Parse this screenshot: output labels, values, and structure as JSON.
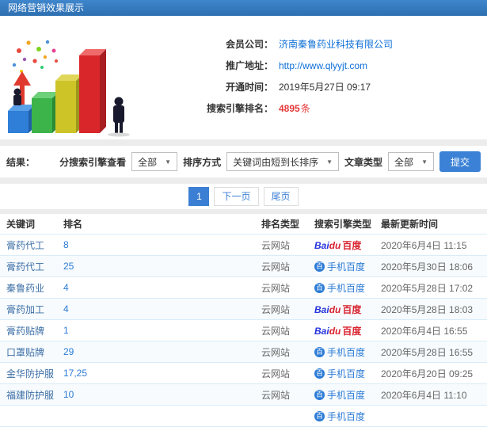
{
  "header": {
    "title": "网络营销效果展示"
  },
  "info": {
    "fields": [
      {
        "label": "会员公司：",
        "value": "济南秦鲁药业科技有限公司"
      },
      {
        "label": "推广地址：",
        "value": "http://www.qlyyjt.com"
      },
      {
        "label": "开通时间：",
        "value": "2019年5月27日 09:17"
      },
      {
        "label": "搜索引擎排名：",
        "value": "4895",
        "suffix": "条"
      }
    ]
  },
  "filters": {
    "result_label": "结果：",
    "engine_label": "分搜索引擎查看",
    "engine_value": "全部",
    "sort_label": "排序方式",
    "sort_value": "关键词由短到长排序",
    "article_label": "文章类型",
    "article_value": "全部",
    "submit_label": "提交"
  },
  "pagination": {
    "current": "1",
    "next_label": "下一页",
    "last_label": "尾页"
  },
  "table": {
    "headers": [
      "关键词",
      "排名",
      "排名类型",
      "搜索引擎类型",
      "最新更新时间"
    ],
    "rows": [
      {
        "keyword": "膏药代工",
        "rank": "8",
        "rank_type": "云网站",
        "engine": "baidu_pc",
        "time": "2020年6月4日 11:15"
      },
      {
        "keyword": "膏药代工",
        "rank": "25",
        "rank_type": "云网站",
        "engine": "baidu_mobile",
        "time": "2020年5月30日 18:06"
      },
      {
        "keyword": "秦鲁药业",
        "rank": "4",
        "rank_type": "云网站",
        "engine": "baidu_mobile",
        "time": "2020年5月28日 17:02"
      },
      {
        "keyword": "膏药加工",
        "rank": "4",
        "rank_type": "云网站",
        "engine": "baidu_pc",
        "time": "2020年5月28日 18:03"
      },
      {
        "keyword": "膏药贴牌",
        "rank": "1",
        "rank_type": "云网站",
        "engine": "baidu_pc",
        "time": "2020年6月4日 16:55"
      },
      {
        "keyword": "口罩贴牌",
        "rank": "29",
        "rank_type": "云网站",
        "engine": "baidu_mobile",
        "time": "2020年5月28日 16:55"
      },
      {
        "keyword": "金华防护服",
        "rank": "17,25",
        "rank_type": "云网站",
        "engine": "baidu_mobile",
        "time": "2020年6月20日 09:25"
      },
      {
        "keyword": "福建防护服",
        "rank": "10",
        "rank_type": "云网站",
        "engine": "baidu_mobile",
        "time": "2020年6月4日 11:10"
      },
      {
        "keyword": "",
        "rank": "",
        "rank_type": "",
        "engine": "baidu_mobile",
        "time": ""
      }
    ]
  },
  "engines": {
    "baidu_pc": {
      "latin": "Bai",
      "latin2": "du",
      "cn": "百度"
    },
    "baidu_mobile": {
      "icon": "百",
      "label": "手机百度"
    }
  },
  "colors": {
    "accent_blue": "#3b7fd4",
    "link_blue": "#0d6fd8",
    "highlight_red": "#e43a3a"
  }
}
